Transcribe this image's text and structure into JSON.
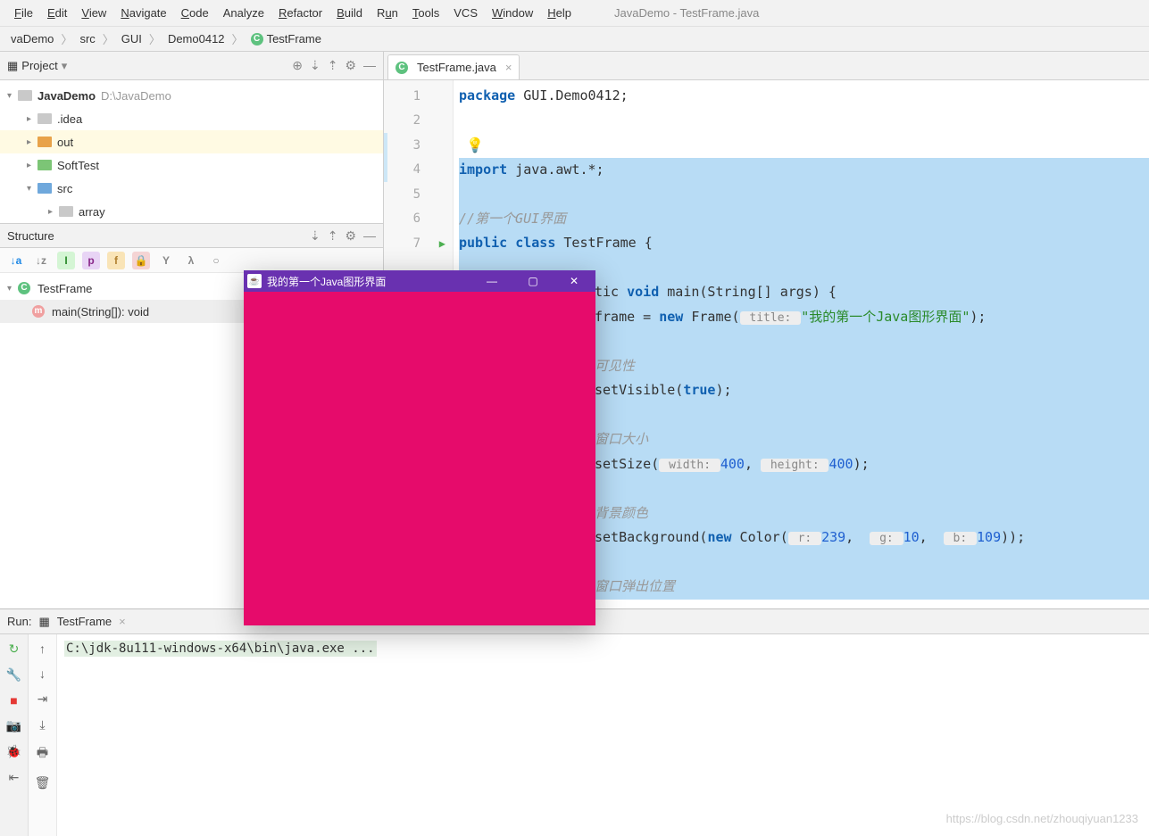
{
  "menubar": {
    "items": [
      "File",
      "Edit",
      "View",
      "Navigate",
      "Code",
      "Analyze",
      "Refactor",
      "Build",
      "Run",
      "Tools",
      "VCS",
      "Window",
      "Help"
    ],
    "title": "JavaDemo - TestFrame.java"
  },
  "breadcrumb": {
    "items": [
      "vaDemo",
      "src",
      "GUI",
      "Demo0412",
      "TestFrame"
    ],
    "icon_on_last": "C"
  },
  "project": {
    "header_label": "Project",
    "root": {
      "name": "JavaDemo",
      "path": "D:\\JavaDemo"
    },
    "items": [
      {
        "name": ".idea",
        "color": "gray",
        "indent": 1
      },
      {
        "name": "out",
        "color": "orange",
        "indent": 1
      },
      {
        "name": "SoftTest",
        "color": "green",
        "indent": 1
      },
      {
        "name": "src",
        "color": "blue",
        "indent": 1,
        "expanded": true
      },
      {
        "name": "array",
        "color": "gray",
        "indent": 2
      }
    ]
  },
  "structure": {
    "header_label": "Structure",
    "class": "TestFrame",
    "method": "main(String[]): void"
  },
  "editor": {
    "tab_label": "TestFrame.java",
    "lines": [
      "1",
      "2",
      "3",
      "4",
      "5",
      "6",
      "7"
    ],
    "code": {
      "l1_pkg": "package",
      "l1_rest": " GUI.Demo0412;",
      "l4_imp": "import",
      "l4_rest": " java.awt.*;",
      "l6_cmt": "//第一个GUI界面",
      "l7_a": "public",
      "l7_b": " class",
      "l7_c": " TestFrame {",
      "l8_a": "tic ",
      "l8_b": "void",
      "l8_c": " main(String[] args) {",
      "l9_a": "frame = ",
      "l9_b": "new",
      "l9_c": " Frame(",
      "l9_hint": " title: ",
      "l9_str": "\"我的第一个Java图形界面\"",
      "l9_end": ");",
      "l10_cmt": "可见性",
      "l11_a": "setVisible(",
      "l11_b": "true",
      "l11_c": ");",
      "l12_cmt": "窗口大小",
      "l13_a": "setSize(",
      "l13_h1": " width: ",
      "l13_v1": "400",
      "l13_m": ", ",
      "l13_h2": " height: ",
      "l13_v2": "400",
      "l13_e": ");",
      "l14_cmt": "背景颜色",
      "l15_a": "setBackground(",
      "l15_b": "new",
      "l15_c": " Color(",
      "l15_rh": " r: ",
      "l15_rv": "239",
      "l15_s1": ",  ",
      "l15_gh": " g: ",
      "l15_gv": "10",
      "l15_s2": ",  ",
      "l15_bh": " b: ",
      "l15_bv": "109",
      "l15_e": "));",
      "l16_cmt": "窗口弹出位置"
    }
  },
  "run": {
    "label": "Run:",
    "tab": "TestFrame",
    "cmd": "C:\\jdk-8u111-windows-x64\\bin\\java.exe ..."
  },
  "java_window": {
    "title": "我的第一个Java图形界面"
  },
  "watermark": "https://blog.csdn.net/zhouqiyuan1233"
}
